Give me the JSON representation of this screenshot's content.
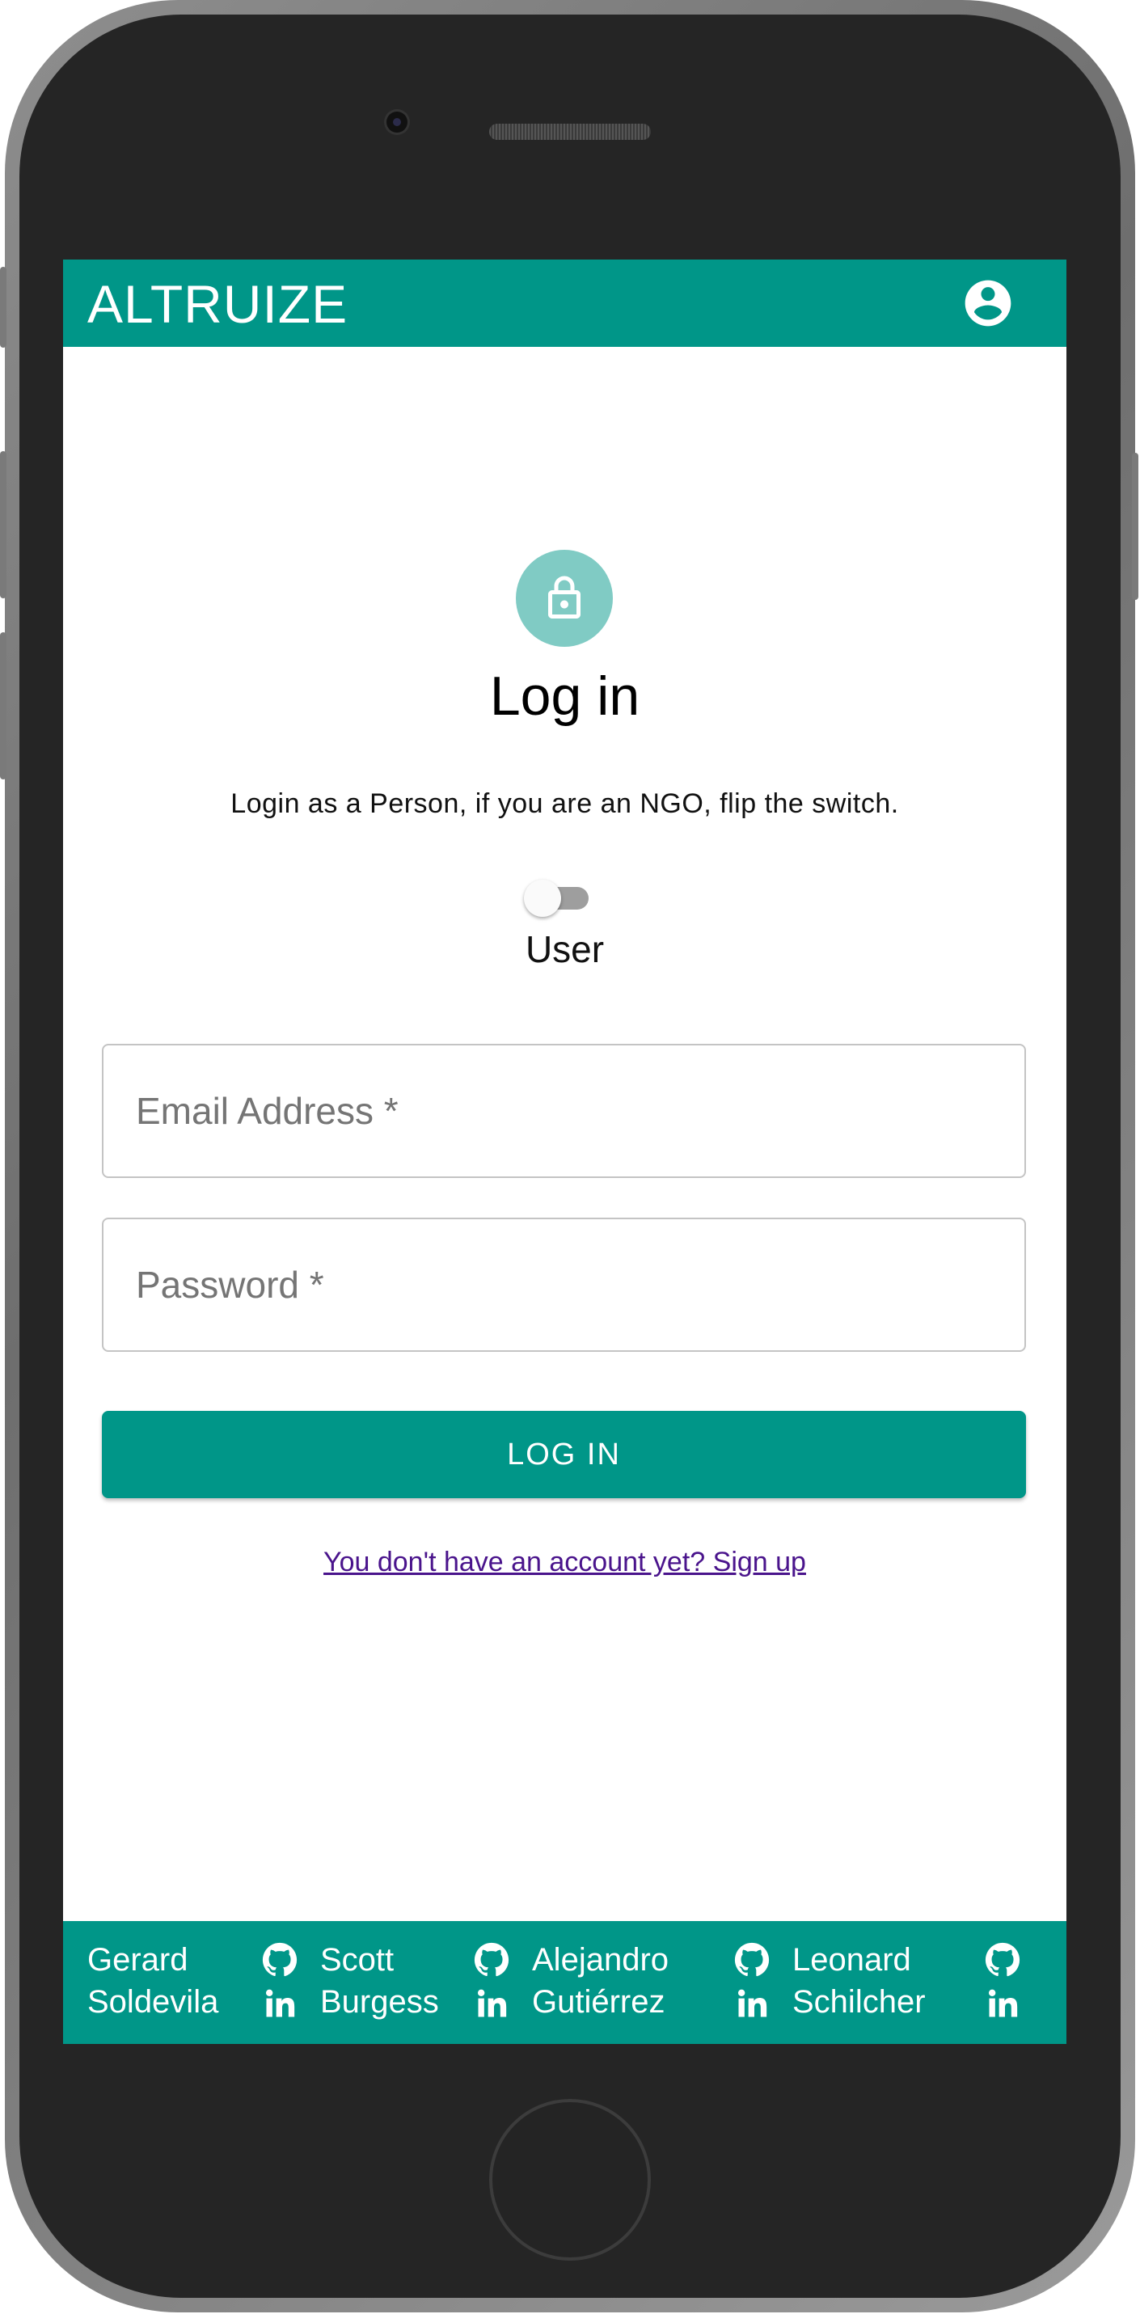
{
  "app": {
    "brand": "ALTRUIZE"
  },
  "login": {
    "title": "Log in",
    "subtitle": "Login as a Person, if you are an NGO, flip the switch.",
    "switch_label": "User",
    "email_placeholder": "Email Address *",
    "password_placeholder": "Password *",
    "button_label": "LOG IN",
    "signup_link": "You don't have an account yet? Sign up"
  },
  "footer": {
    "people": [
      {
        "first": "Gerard",
        "last": "Soldevila"
      },
      {
        "first": "Scott",
        "last": "Burgess"
      },
      {
        "first": "Alejandro",
        "last": "Gutiérrez"
      },
      {
        "first": "Leonard",
        "last": "Schilcher"
      }
    ]
  },
  "icons": [
    "account-circle-icon",
    "lock-icon",
    "github-icon",
    "linkedin-icon"
  ],
  "colors": {
    "primary": "#009688",
    "avatar": "#80cbc4",
    "link": "#4a148c",
    "frame": "#252525"
  }
}
